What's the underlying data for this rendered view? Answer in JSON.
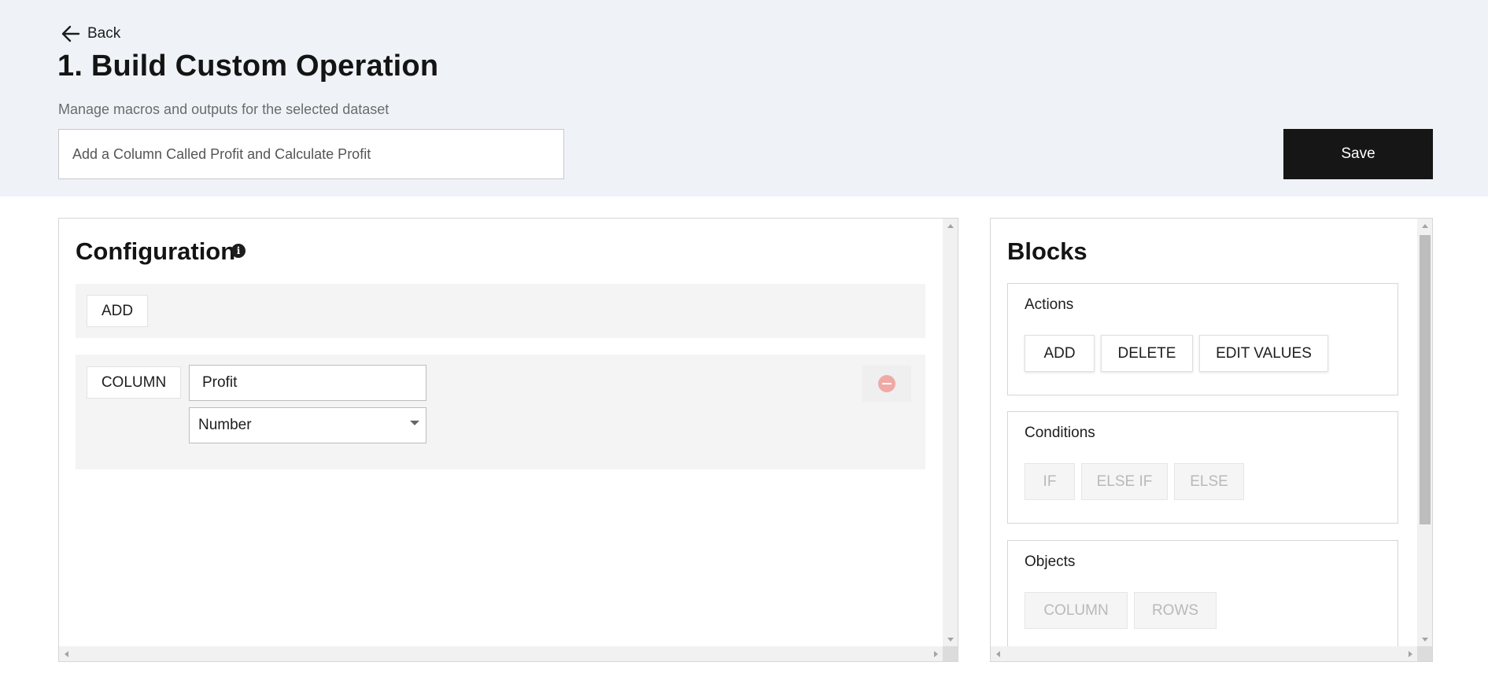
{
  "header": {
    "back_label": "Back",
    "title": "1. Build Custom Operation",
    "subtitle": "Manage macros and outputs for the selected dataset",
    "description_value": "Add a Column Called Profit and Calculate Profit",
    "save_label": "Save"
  },
  "config": {
    "title": "Configuration",
    "info_icon": "info-icon",
    "action_button": "ADD",
    "object_button": "COLUMN",
    "column_name": "Profit",
    "column_type": "Number",
    "remove_icon": "minus-circle-icon"
  },
  "blocks": {
    "title": "Blocks",
    "actions": {
      "title": "Actions",
      "buttons": [
        "ADD",
        "DELETE",
        "EDIT VALUES"
      ]
    },
    "conditions": {
      "title": "Conditions",
      "buttons": [
        "IF",
        "ELSE IF",
        "ELSE"
      ]
    },
    "objects": {
      "title": "Objects",
      "buttons": [
        "COLUMN",
        "ROWS"
      ]
    }
  },
  "colors": {
    "header_bg": "#eff3f7",
    "save_bg": "#161616",
    "remove_icon": "#efaaa6",
    "disabled_text": "#b9b9b9"
  }
}
